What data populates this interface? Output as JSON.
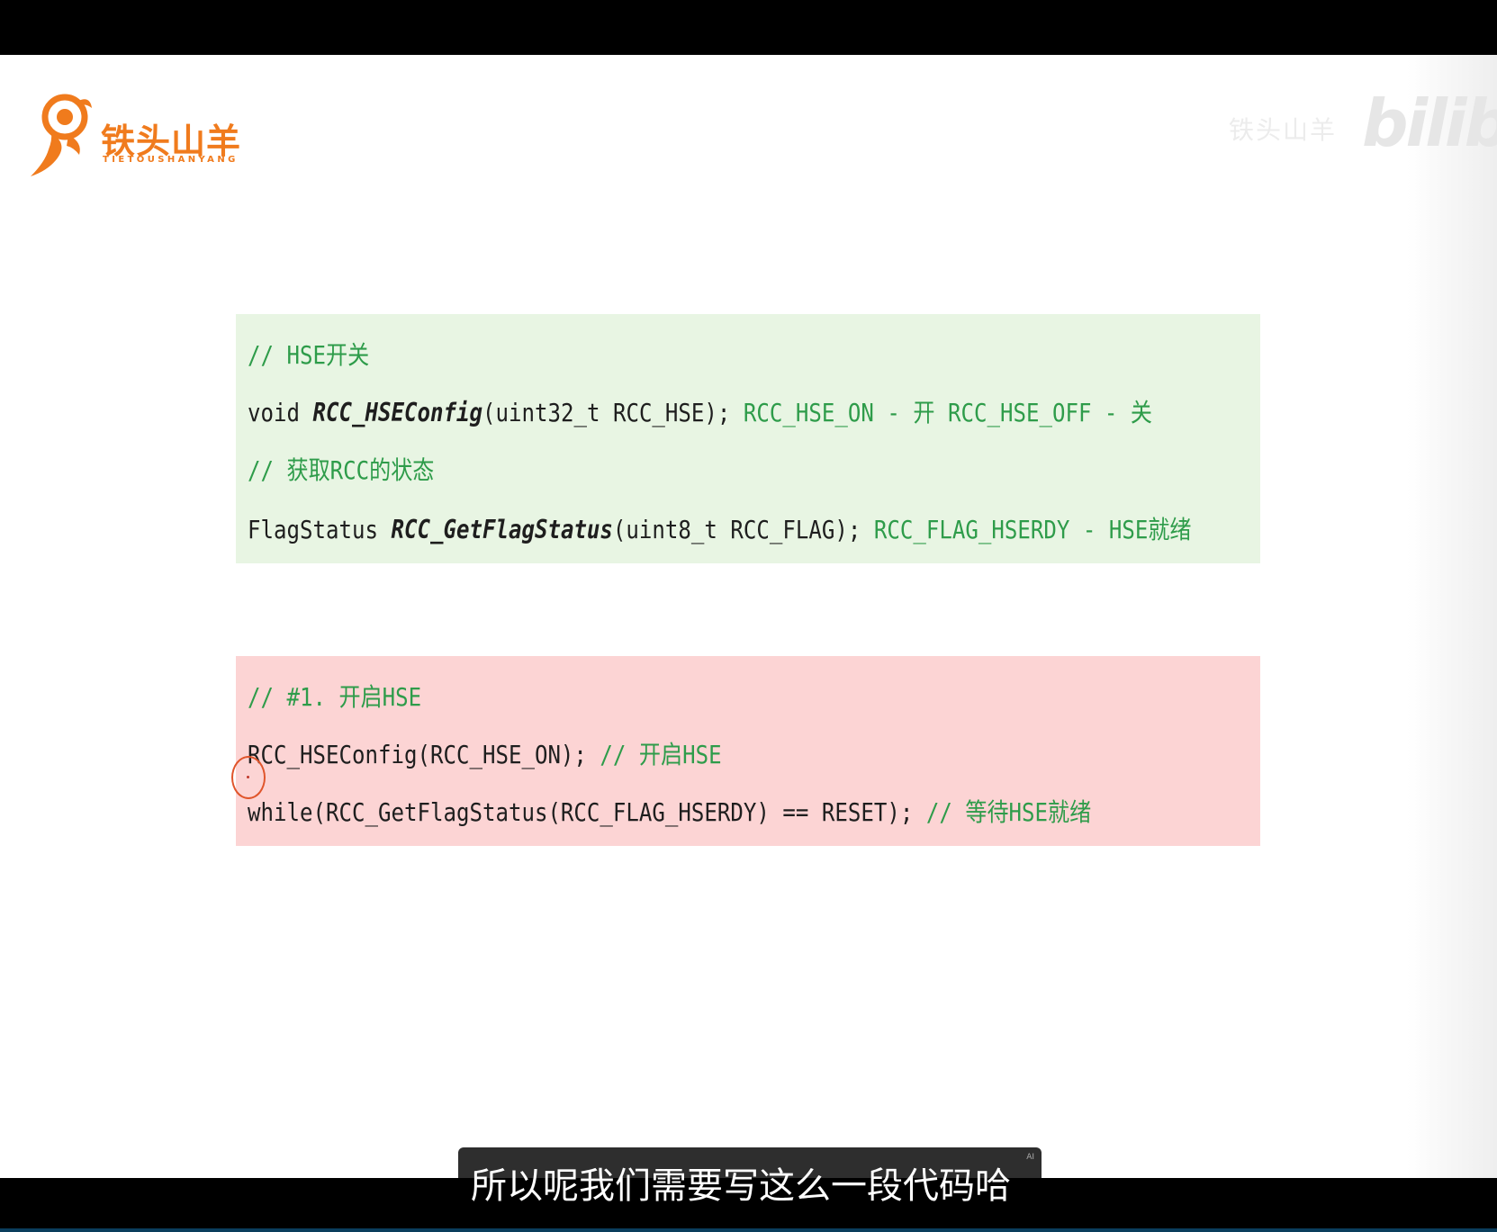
{
  "logo": {
    "name": "铁头山羊",
    "subtitle": "TIETOUSHANYANG"
  },
  "watermark": {
    "user": "铁头山羊",
    "brand": "bilibili"
  },
  "green_box": {
    "line1": {
      "comment": "// HSE开关"
    },
    "line2": {
      "ret": "void ",
      "func": "RCC_HSEConfig",
      "args": "(uint32_t RCC_HSE);",
      "note": " RCC_HSE_ON - 开 RCC_HSE_OFF - 关"
    },
    "line3": {
      "comment": "// 获取RCC的状态"
    },
    "line4": {
      "ret": "FlagStatus ",
      "func": "RCC_GetFlagStatus",
      "args": "(uint8_t RCC_FLAG);",
      "note": " RCC_FLAG_HSERDY - HSE就绪"
    }
  },
  "red_box": {
    "line1": {
      "comment": "// #1. 开启HSE"
    },
    "line2": {
      "code": "RCC_HSEConfig(RCC_HSE_ON); ",
      "comment": "// 开启HSE"
    },
    "line3": {
      "code": "while(RCC_GetFlagStatus(RCC_FLAG_HSERDY) == RESET); ",
      "comment": "// 等待HSE就绪"
    }
  },
  "subtitle": {
    "text": "所以呢我们需要写这么一段代码哈",
    "badge": "AI"
  },
  "colors": {
    "comment": "#2e9c4a",
    "green_bg": "#e8f5e3",
    "red_bg": "#fcd4d4",
    "logo": "#f07b1d"
  },
  "icons": [
    "goat-logo-icon",
    "cursor-ring-icon"
  ]
}
